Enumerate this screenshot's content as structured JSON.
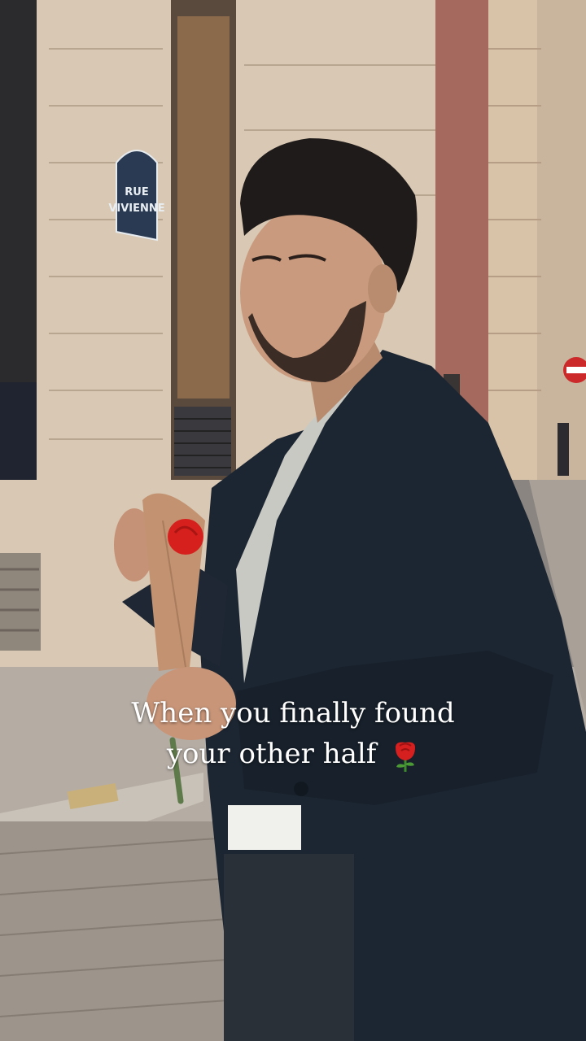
{
  "photo": {
    "street_sign": {
      "line1": "RUE",
      "line2": "VIVIENNE"
    }
  },
  "caption": {
    "line1": "When you finally found",
    "line2": "your other half",
    "emoji": "rose-icon"
  },
  "colors": {
    "coat": "#1c2632",
    "stone": "#d8c7b2",
    "brick": "#a0665a",
    "cobblestone": "#a59d95",
    "rose": "#d61f1f",
    "kraft_paper": "#c09270",
    "caption_text": "#ffffff"
  }
}
